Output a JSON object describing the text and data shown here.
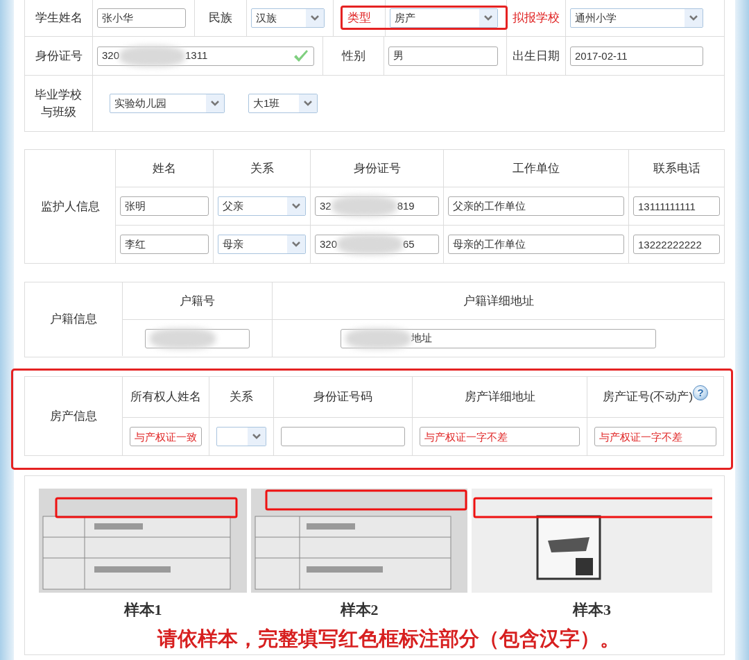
{
  "student": {
    "lines": [
      {
        "fields": [
          {
            "label": "学生姓名",
            "required": false,
            "controls": [
              {
                "kind": "input",
                "value": "张小华"
              }
            ]
          },
          {
            "label": "民族",
            "required": false,
            "controls": [
              {
                "kind": "select",
                "value": "汉族"
              }
            ]
          },
          {
            "label": "类型",
            "required": true,
            "highlighted": true,
            "controls": [
              {
                "kind": "select",
                "value": "房产"
              }
            ]
          },
          {
            "label": "拟报学校",
            "required": true,
            "controls": [
              {
                "kind": "select",
                "value": "通州小学"
              }
            ]
          }
        ]
      },
      {
        "fields": [
          {
            "label": "身份证号",
            "required": false,
            "controls": [
              {
                "kind": "input",
                "value_before": "320",
                "value_after": "1311",
                "redacted": true,
                "valid": true
              }
            ]
          },
          {
            "label": "性别",
            "required": false,
            "controls": [
              {
                "kind": "input",
                "value": "男"
              }
            ]
          },
          {
            "label": "出生日期",
            "required": false,
            "controls": [
              {
                "kind": "input",
                "value": "2017-02-11"
              }
            ]
          }
        ]
      },
      {
        "fields": [
          {
            "label": "毕业学校与班级",
            "required": false,
            "controls": [
              {
                "kind": "select",
                "value": "实验幼儿园"
              },
              {
                "kind": "select",
                "value": "大1班"
              }
            ]
          }
        ]
      }
    ]
  },
  "guardians": {
    "title": "监护人信息",
    "columns": [
      "姓名",
      "关系",
      "身份证号",
      "工作单位",
      "联系电话"
    ],
    "rows": [
      {
        "name": "张明",
        "relation": "父亲",
        "id_before": "32",
        "id_after": "819",
        "employer": "父亲的工作单位",
        "phone": "13111111111"
      },
      {
        "name": "李红",
        "relation": "母亲",
        "id_before": "320",
        "id_after": "65",
        "employer": "母亲的工作单位",
        "phone": "13222222222"
      }
    ]
  },
  "household": {
    "title": "户籍信息",
    "columns": [
      "户籍号",
      "户籍详细地址"
    ],
    "number": {
      "redacted": true
    },
    "address": {
      "redacted": true,
      "value_after": "地址"
    }
  },
  "property": {
    "title": "房产信息",
    "highlighted": true,
    "columns": [
      "所有权人姓名",
      "关系",
      "身份证号码",
      "房产详细地址",
      "房产证号(不动产)"
    ],
    "help_icon": "?",
    "fields": [
      {
        "kind": "input",
        "placeholder": "与产权证一致"
      },
      {
        "kind": "select"
      },
      {
        "kind": "input"
      },
      {
        "kind": "input",
        "placeholder": "与产权证一字不差"
      },
      {
        "kind": "input",
        "placeholder": "与产权证一字不差"
      }
    ]
  },
  "samples": {
    "items": [
      {
        "kind": "picture",
        "caption": "样本1"
      },
      {
        "kind": "picture",
        "caption": "样本2"
      },
      {
        "kind": "picture",
        "caption": "样本3"
      }
    ],
    "notice": "请依样本，完整填写红色框标注部分（包含汉字）。"
  }
}
